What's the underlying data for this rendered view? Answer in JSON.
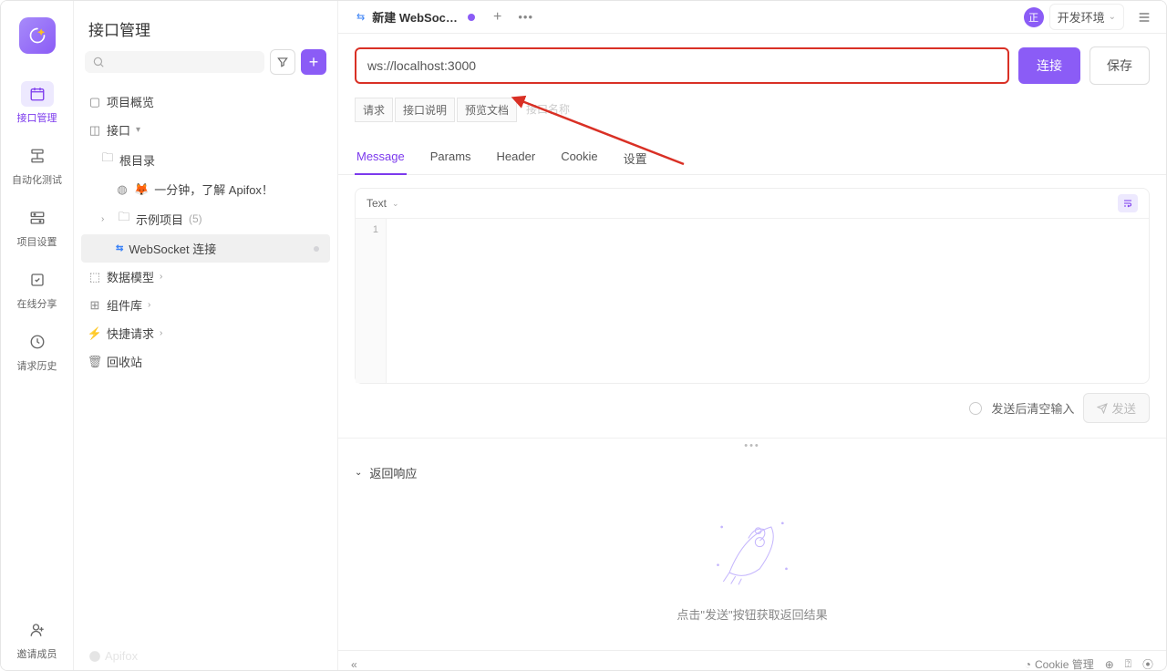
{
  "rail": {
    "items": [
      {
        "label": "接口管理"
      },
      {
        "label": "自动化测试"
      },
      {
        "label": "项目设置"
      },
      {
        "label": "在线分享"
      },
      {
        "label": "请求历史"
      }
    ],
    "invite": "邀请成员"
  },
  "sidebar": {
    "title": "接口管理",
    "search_placeholder": "Q",
    "overview": "项目概览",
    "api_root": "接口",
    "root_dir": "根目录",
    "intro_doc": "一分钟，了解 Apifox！",
    "example_project": "示例项目",
    "example_count": "(5)",
    "ws_item": "WebSocket 连接",
    "data_model": "数据模型",
    "components": "组件库",
    "quick_request": "快捷请求",
    "recycle": "回收站",
    "watermark": "Apifox"
  },
  "tabbar": {
    "tab_title": "新建 WebSocket 接...",
    "env_label": "开发环境",
    "env_initial": "正"
  },
  "request": {
    "url": "ws://localhost:3000",
    "connect": "连接",
    "save": "保存"
  },
  "subtabs1": {
    "t1": "请求",
    "t2": "接口说明",
    "t3": "预览文档",
    "t4": "接口名称"
  },
  "subtabs2": {
    "t1": "Message",
    "t2": "Params",
    "t3": "Header",
    "t4": "Cookie",
    "t5": "设置"
  },
  "message": {
    "format": "Text",
    "line1": "1",
    "clear_after_send": "发送后清空输入",
    "send": "发送"
  },
  "response": {
    "title": "返回响应",
    "hint": "点击\"发送\"按钮获取返回结果"
  },
  "footer": {
    "cookie": "Cookie 管理"
  }
}
